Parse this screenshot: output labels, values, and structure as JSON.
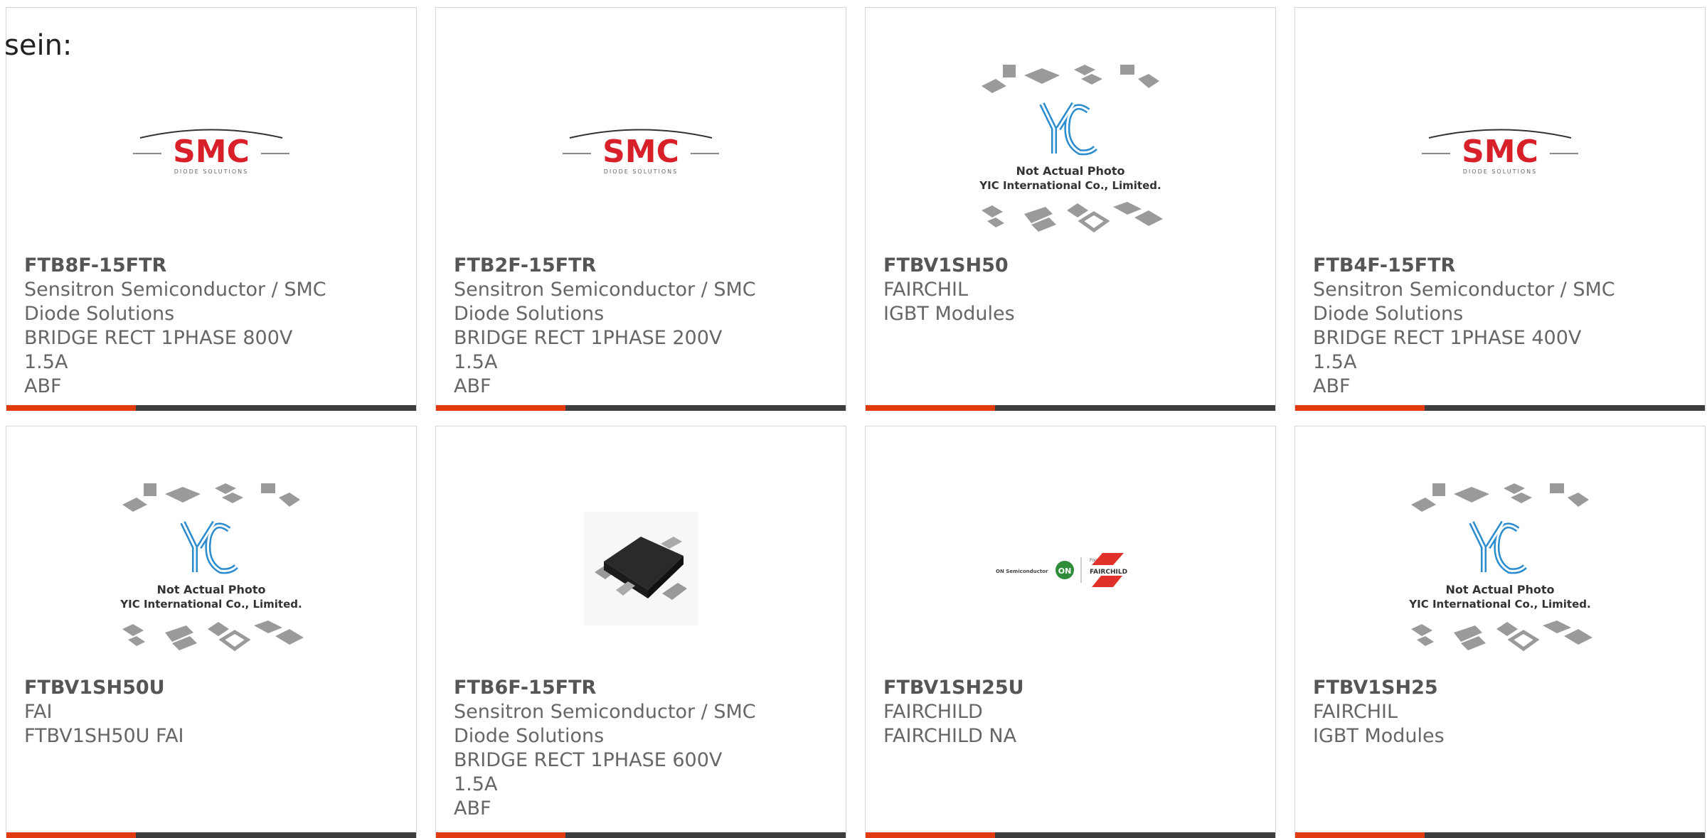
{
  "lead_text": "sein:",
  "colors": {
    "accent": "#e23b10",
    "bar": "#3d3d3d",
    "smc_red": "#d8202a",
    "yic_blue": "#2a8ccf"
  },
  "logos": {
    "smc": {
      "brand": "SMC",
      "tagline": "DIODE SOLUTIONS"
    },
    "yic": {
      "line1": "Not Actual Photo",
      "line2": "YIC International Co., Limited."
    },
    "onfc": {
      "left": "ON Semiconductor",
      "badge": "ON",
      "right_small": "Formerly",
      "right": "FAIRCHILD"
    }
  },
  "products": [
    {
      "part": "FTB8F-15FTR",
      "lines": [
        "Sensitron Semiconductor / SMC",
        "Diode Solutions",
        "BRIDGE RECT 1PHASE 800V 1.5A",
        "ABF"
      ],
      "image": "smc-logo"
    },
    {
      "part": "FTB2F-15FTR",
      "lines": [
        "Sensitron Semiconductor / SMC",
        "Diode Solutions",
        "BRIDGE RECT 1PHASE 200V 1.5A",
        "ABF"
      ],
      "image": "smc-logo"
    },
    {
      "part": "FTBV1SH50",
      "lines": [
        "FAIRCHIL",
        "IGBT Modules"
      ],
      "image": "yic-placeholder"
    },
    {
      "part": "FTB4F-15FTR",
      "lines": [
        "Sensitron Semiconductor / SMC",
        "Diode Solutions",
        "BRIDGE RECT 1PHASE 400V 1.5A",
        "ABF"
      ],
      "image": "smc-logo"
    },
    {
      "part": "FTBV1SH50U",
      "lines": [
        "FAI",
        "FTBV1SH50U FAI"
      ],
      "image": "yic-placeholder"
    },
    {
      "part": "FTB6F-15FTR",
      "lines": [
        "Sensitron Semiconductor / SMC",
        "Diode Solutions",
        "BRIDGE RECT 1PHASE 600V 1.5A",
        "ABF"
      ],
      "image": "component-photo"
    },
    {
      "part": "FTBV1SH25U",
      "lines": [
        "FAIRCHILD",
        "FAIRCHILD NA"
      ],
      "image": "onsemi-fairchild-logo"
    },
    {
      "part": "FTBV1SH25",
      "lines": [
        "FAIRCHIL",
        "IGBT Modules"
      ],
      "image": "yic-placeholder"
    }
  ]
}
